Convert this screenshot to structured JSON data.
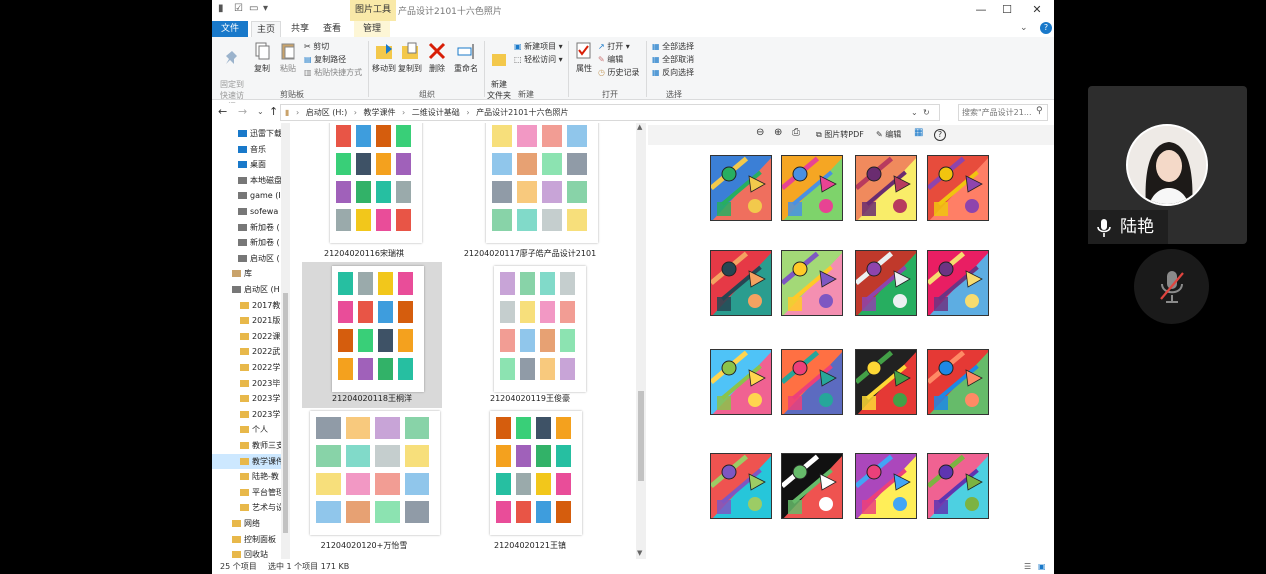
{
  "window": {
    "context_tab": "图片工具",
    "title": "产品设计2101十六色照片",
    "controls": {
      "minimize": "—",
      "maximize": "☐",
      "close": "✕"
    }
  },
  "ribbon_tabs": {
    "file": "文件",
    "home": "主页",
    "share": "共享",
    "view": "查看",
    "manage": "管理"
  },
  "ribbon": {
    "pin": "固定到\n快速访问",
    "copy": "复制",
    "paste": "粘贴",
    "cut": "剪切",
    "copy_path": "复制路径",
    "paste_shortcut": "粘贴快捷方式",
    "clipboard_group": "剪贴板",
    "move_to": "移动到",
    "copy_to": "复制到",
    "delete": "删除",
    "rename": "重命名",
    "organize_group": "组织",
    "new_folder": "新建\n文件夹",
    "new_item": "新建项目",
    "easy_access": "轻松访问",
    "new_group": "新建",
    "properties": "属性",
    "open": "打开",
    "edit": "编辑",
    "history": "历史记录",
    "open_group": "打开",
    "select_all": "全部选择",
    "select_none": "全部取消",
    "invert": "反向选择",
    "select_group": "选择"
  },
  "address": {
    "segments": [
      "启动区 (H:)",
      "教学课件",
      "二维设计基础",
      "产品设计2101十六色照片"
    ],
    "search_placeholder": "搜索\"产品设计21...",
    "nav_back": "←",
    "nav_forward": "→",
    "nav_up": "↑",
    "refresh": "↻"
  },
  "nav_items": [
    "迅雷下载",
    "音乐",
    "桌面",
    "本地磁盘",
    "game (I",
    "sofewa",
    "新加卷 (",
    "新加卷 (",
    "启动区 (",
    "库",
    "启动区 (H",
    "2017教",
    "2021版",
    "2022课",
    "2022武",
    "2022学",
    "2023毕",
    "2023学",
    "2023学",
    "个人",
    "教师三支",
    "教学课件",
    "陆艳-教",
    "平台管理",
    "艺术与设",
    "网络",
    "控制面板",
    "回收站"
  ],
  "files": [
    {
      "name": "21204020116宋瑞祺"
    },
    {
      "name": "21204020117廖子皓产品设计2101"
    },
    {
      "name": "21204020118王桐洋"
    },
    {
      "name": "21204020119王俊豪"
    },
    {
      "name": "21204020120+万怡雪"
    },
    {
      "name": "21204020121王镇"
    }
  ],
  "preview_toolbar": {
    "zoom_out": "⊖",
    "zoom_in": "⊕",
    "print": "⎙",
    "to_pdf": "图片转PDF",
    "edit": "编辑",
    "help": "?"
  },
  "status": {
    "count": "25 个项目",
    "selection": "选中 1 个项目  171 KB"
  },
  "meeting": {
    "participant": "陆艳"
  },
  "colors": {
    "accent": "#1979ca",
    "selection": "#cde8ff",
    "ribbon_bg": "#f5f6f7"
  }
}
